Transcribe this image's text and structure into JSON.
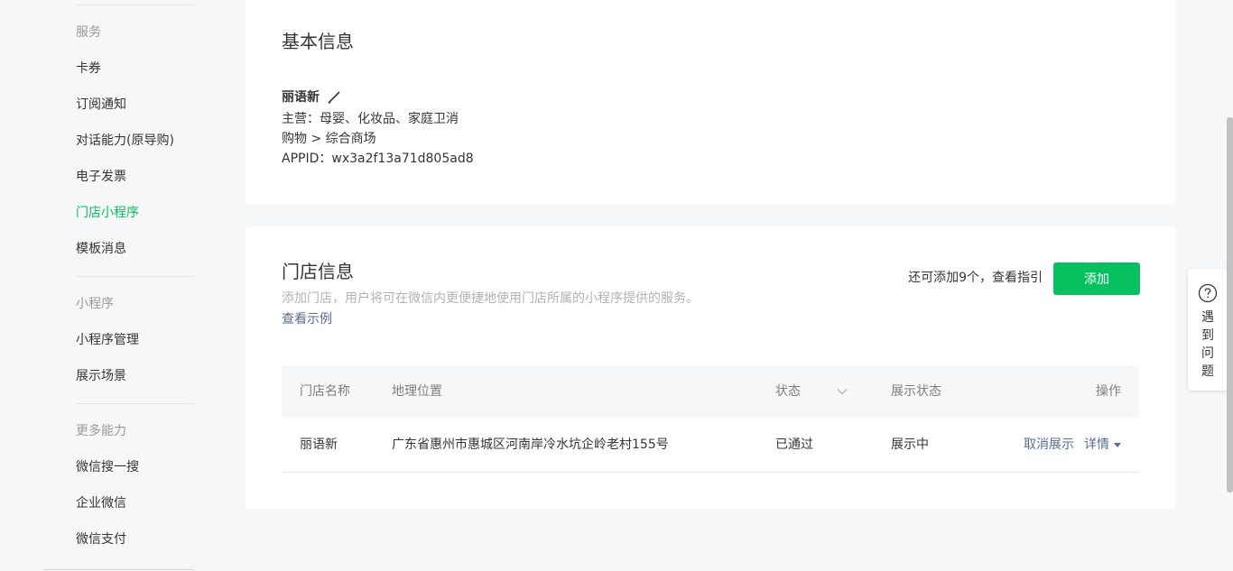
{
  "sidebar": {
    "groups": [
      {
        "title": "服务",
        "items": [
          "卡券",
          "订阅通知",
          "对话能力(原导购)",
          "电子发票",
          "门店小程序",
          "模板消息"
        ]
      },
      {
        "title": "小程序",
        "items": [
          "小程序管理",
          "展示场景"
        ]
      },
      {
        "title": "更多能力",
        "items": [
          "微信搜一搜",
          "企业微信",
          "微信支付"
        ]
      }
    ],
    "active_item": "门店小程序"
  },
  "basic_info": {
    "title": "基本信息",
    "name": "丽语新",
    "main_business": "主营：母婴、化妆品、家庭卫消",
    "category": "购物 > 综合商场",
    "appid": "APPID：wx3a2f13a71d805ad8"
  },
  "store_info": {
    "title": "门店信息",
    "description": "添加门店，用户将可在微信内更便捷地使用门店所属的小程序提供的服务。",
    "example_link": "查看示例",
    "quota_text": "还可添加9个，",
    "guide_link": "查看指引",
    "add_button": "添加",
    "table": {
      "headers": [
        "门店名称",
        "地理位置",
        "状态",
        "展示状态",
        "操作"
      ],
      "rows": [
        {
          "name": "丽语新",
          "location": "广东省惠州市惠城区河南岸冷水坑企岭老村155号",
          "status": "已通过",
          "display_status": "展示中",
          "action_cancel": "取消展示",
          "action_detail": "详情"
        }
      ]
    }
  },
  "help": {
    "label": "遇到问题"
  },
  "colors": {
    "accent_green": "#07c160",
    "link_blue": "#576b95",
    "page_bg": "#f6f7f9"
  },
  "icons": [
    "edit-pencil-icon",
    "chevron-down-icon",
    "caret-down-icon",
    "question-circle-icon"
  ]
}
